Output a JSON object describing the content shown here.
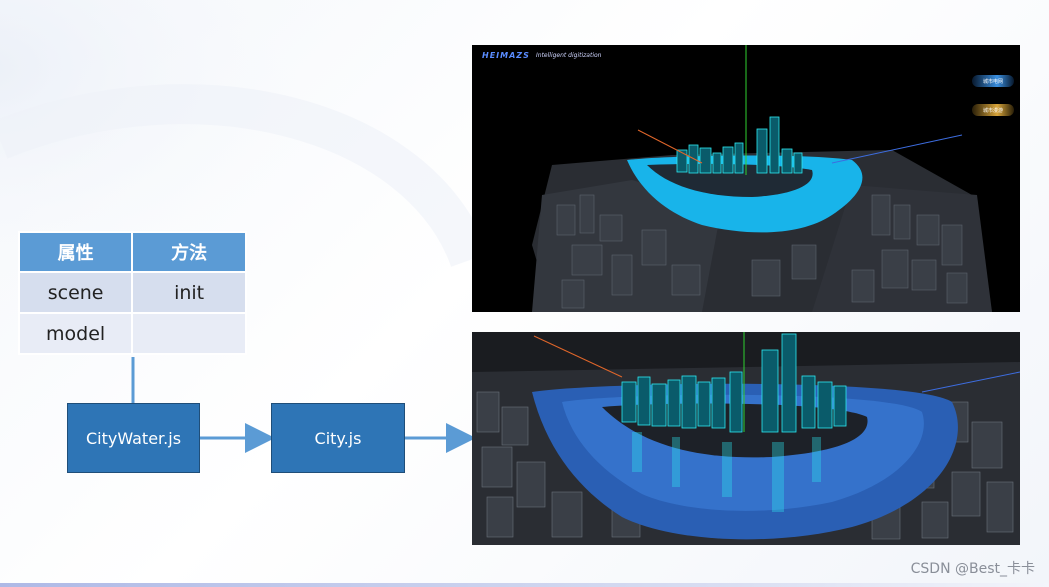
{
  "table": {
    "headers": [
      "属性",
      "方法"
    ],
    "rows": [
      [
        "scene",
        "init"
      ],
      [
        "model",
        ""
      ]
    ]
  },
  "boxes": {
    "city_water": "CityWater.js",
    "city": "City.js"
  },
  "screenshot_top": {
    "brand": "HEIMAZS",
    "brand_sub": "Intelligent  digitization",
    "legend": [
      "城市电网",
      "城市漫游"
    ]
  },
  "watermark": "CSDN @Best_卡卡",
  "colors": {
    "header_blue": "#5b9bd5",
    "row_light": "#d6deee",
    "row_lighter": "#e8ecf6",
    "box_blue": "#2e75b6",
    "arrow_blue": "#5b9bd5",
    "water_cyan": "#18b4ea",
    "building_cyan": "#2ee9f2"
  }
}
